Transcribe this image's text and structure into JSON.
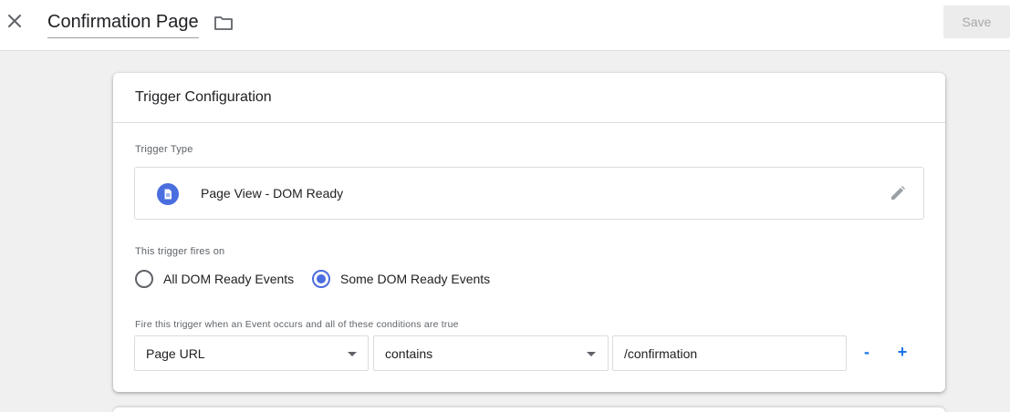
{
  "header": {
    "title": "Confirmation Page",
    "save_label": "Save",
    "close_icon": "close-icon",
    "folder_icon": "folder-icon"
  },
  "card": {
    "title": "Trigger Configuration",
    "trigger_type_label": "Trigger Type",
    "trigger_type": {
      "name": "Page View - DOM Ready",
      "icon": "document-icon",
      "edit_icon": "pencil-icon",
      "icon_color": "#4a6ee0"
    },
    "fires_on_label": "This trigger fires on",
    "fires_on_options": [
      {
        "label": "All DOM Ready Events",
        "selected": false
      },
      {
        "label": "Some DOM Ready Events",
        "selected": true
      }
    ],
    "conditions_label": "Fire this trigger when an Event occurs and all of these conditions are true",
    "condition": {
      "variable": "Page URL",
      "operator": "contains",
      "value": "/confirmation",
      "remove_label": "-",
      "add_label": "+"
    }
  },
  "colors": {
    "accent": "#4a6ee0",
    "link": "#1a73e8"
  }
}
